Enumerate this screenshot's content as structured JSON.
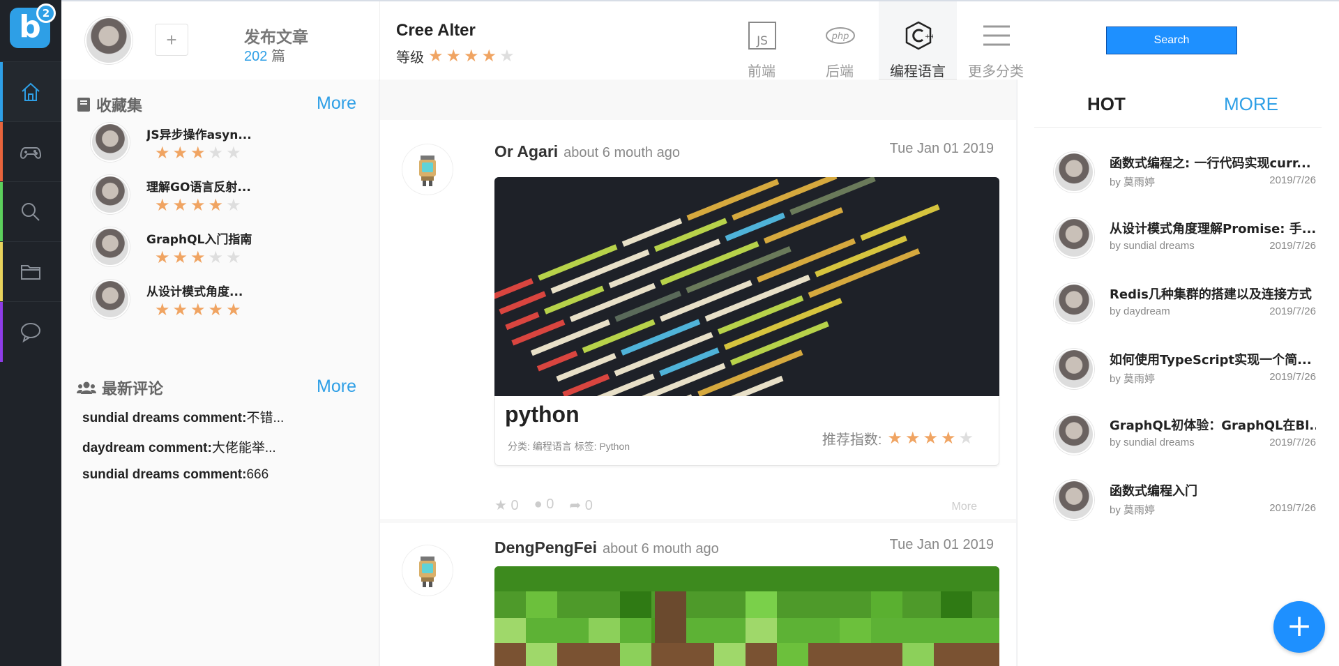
{
  "app": {
    "logo_letter": "b",
    "logo_superscript": "2"
  },
  "rail": {
    "items": [
      {
        "name": "home",
        "color": "#2e9fe6"
      },
      {
        "name": "gamepad",
        "color": "#e8643c"
      },
      {
        "name": "search",
        "color": "#5cd05c"
      },
      {
        "name": "folder",
        "color": "#e8d25c"
      },
      {
        "name": "chat",
        "color": "#8e3ce8"
      }
    ]
  },
  "header": {
    "add_label": "+",
    "publish_label": "发布文章",
    "publish_count": "202",
    "publish_unit": "篇",
    "user_name": "Cree Alter",
    "level_label": "等级",
    "level_rating": 4,
    "categories": [
      {
        "label": "前端",
        "icon": "js-icon"
      },
      {
        "label": "后端",
        "icon": "php-icon"
      },
      {
        "label": "编程语言",
        "icon": "cpp-icon"
      },
      {
        "label": "更多分类",
        "icon": "menu-icon"
      }
    ],
    "search_label": "Search"
  },
  "left": {
    "favorites_title": "收藏集",
    "favorites_more": "More",
    "favorites": [
      {
        "title": "JS异步操作asyn...",
        "rating": 3
      },
      {
        "title": "理解GO语言反射...",
        "rating": 4
      },
      {
        "title": "GraphQL入门指南",
        "rating": 3
      },
      {
        "title": "从设计模式角度...",
        "rating": 5
      }
    ],
    "comments_title": "最新评论",
    "comments_more": "More",
    "comments": [
      {
        "user": "sundial dreams comment:",
        "text": "不错..."
      },
      {
        "user": "daydream comment:",
        "text": "大佬能举..."
      },
      {
        "user": "sundial dreams comment:",
        "text": "666"
      }
    ]
  },
  "feed": {
    "posts": [
      {
        "author": "Or Agari",
        "ago": "about 6 mouth ago",
        "date": "Tue Jan 01 2019",
        "title": "python",
        "meta": "分类: 编程语言 标签: Python",
        "rec_label": "推荐指数:",
        "rating": 4,
        "likes": "0",
        "comments": "0",
        "shares": "0",
        "more": "More"
      },
      {
        "author": "DengPengFei",
        "ago": "about 6 mouth ago",
        "date": "Tue Jan 01 2019"
      }
    ]
  },
  "hot": {
    "title": "HOT",
    "more": "MORE",
    "items": [
      {
        "title": "函数式编程之: 一行代码实现curr...",
        "by": "by 莫雨婷",
        "date": "2019/7/26"
      },
      {
        "title": "从设计模式角度理解Promise: 手...",
        "by": "by sundial dreams",
        "date": "2019/7/26"
      },
      {
        "title": "Redis几种集群的搭建以及连接方式",
        "by": "by daydream",
        "date": "2019/7/26"
      },
      {
        "title": "如何使用TypeScript实现一个简...",
        "by": "by 莫雨婷",
        "date": "2019/7/26"
      },
      {
        "title": "GraphQL初体验：GraphQL在Bl...",
        "by": "by sundial dreams",
        "date": "2019/7/26"
      },
      {
        "title": "函数式编程入门",
        "by": "by 莫雨婷",
        "date": "2019/7/26"
      }
    ]
  },
  "fab_label": "+"
}
